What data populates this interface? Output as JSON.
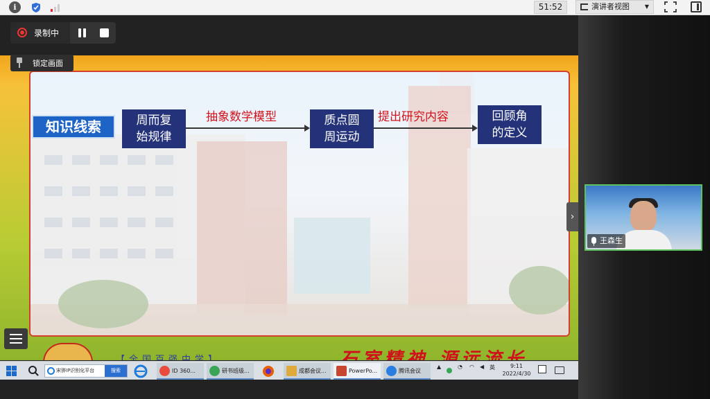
{
  "topbar": {
    "timer": "51:52",
    "presenter_view_label": "演讲者视图"
  },
  "recording": {
    "label": "录制中",
    "lock_label": "锁定画面"
  },
  "slide": {
    "title": "知识线索",
    "nodes": [
      "周而复\n始规律",
      "质点圆\n周运动",
      "回顾角\n的定义"
    ],
    "edges": [
      "抽象数学模型",
      "提出研究内容"
    ],
    "footer_school": "【全国百强中学】",
    "footer_motto": "石室精神 源远流长"
  },
  "video": {
    "participant_name": "王森生"
  },
  "taskbar": {
    "search_text": "宋骅IP识别化平台",
    "search_button": "搜索",
    "apps": [
      {
        "label": "ID 360...",
        "color": "#e94b3c"
      },
      {
        "label": "研书班级...",
        "color": "#3aa655"
      },
      {
        "label": "成都会议...",
        "color": "#e0a93b"
      },
      {
        "label": "PowerPo...",
        "color": "#c8462f"
      },
      {
        "label": "腾讯会议",
        "color": "#2a7de1"
      }
    ],
    "ime": "英",
    "time": "9:11",
    "date": "2022/4/30"
  },
  "colors": {
    "slide_node": "#24327a",
    "slide_title": "#1e63c6",
    "edge_label": "#d1141e",
    "video_border": "#5dc25d"
  }
}
